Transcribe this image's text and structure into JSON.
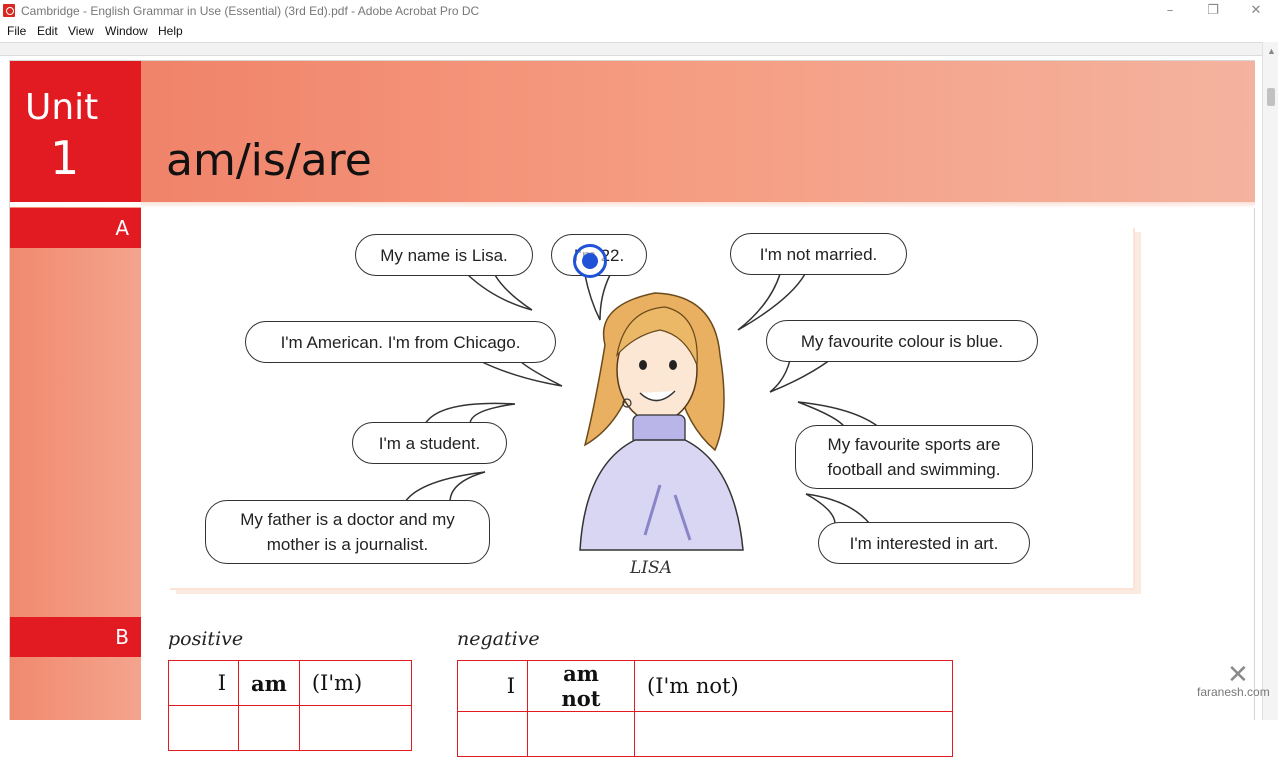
{
  "window": {
    "title": "Cambridge - English Grammar in Use (Essential) (3rd Ed).pdf - Adobe Acrobat Pro DC",
    "controls": {
      "minimize": "–",
      "restore": "❐",
      "close": "✕"
    }
  },
  "menu": {
    "items": [
      "File",
      "Edit",
      "View",
      "Window",
      "Help"
    ]
  },
  "page": {
    "unit_word": "Unit",
    "unit_number": "1",
    "title": "am/is/are",
    "section_a": "A",
    "section_b": "B",
    "character_name": "LISA",
    "bubbles": {
      "name": "My name is Lisa.",
      "age": "I'm 22.",
      "not_married": "I'm not married.",
      "american": "I'm American. I'm from Chicago.",
      "colour": "My favourite colour is blue.",
      "student": "I'm a student.",
      "sports_line1": "My favourite sports are",
      "sports_line2": "football and swimming.",
      "father_line1": "My father is a doctor and my",
      "father_line2": "mother is a journalist.",
      "interested": "I'm interested in art."
    },
    "positive_label": "positive",
    "negative_label": "negative",
    "positive_row": [
      "I",
      "am",
      "(I'm)"
    ],
    "negative_row": [
      "I",
      "am not",
      "(I'm not)"
    ]
  },
  "watermark": {
    "mark": "✕",
    "text": "faranesh.com"
  },
  "colors": {
    "unit_red": "#e21a22",
    "header_salmon": "#f59b80",
    "cursor_blue": "#1f52d6"
  }
}
